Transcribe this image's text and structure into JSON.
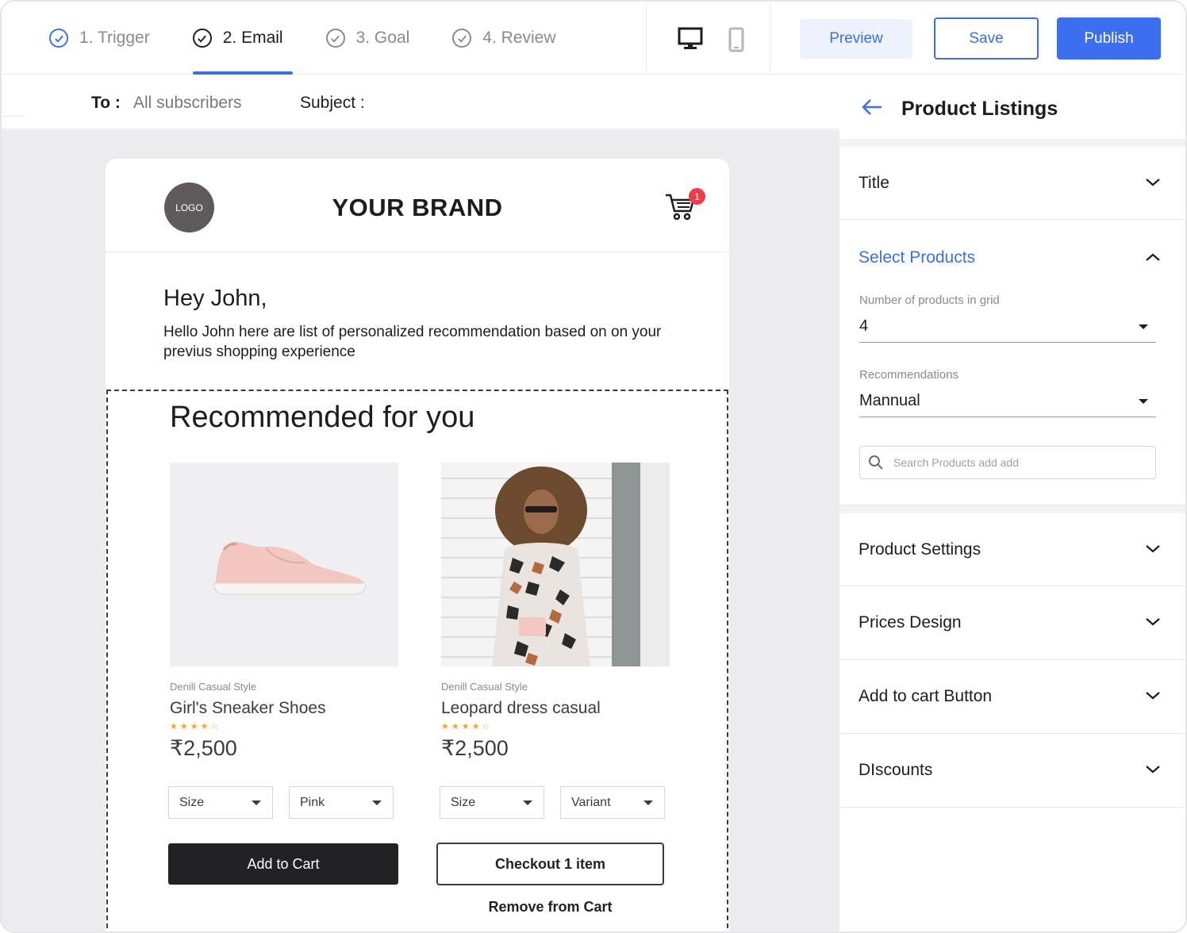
{
  "steps": [
    {
      "label": "1. Trigger",
      "state": "done"
    },
    {
      "label": "2. Email",
      "state": "active"
    },
    {
      "label": "3. Goal",
      "state": "pending"
    },
    {
      "label": "4. Review",
      "state": "pending"
    }
  ],
  "toolbar": {
    "preview": "Preview",
    "save": "Save",
    "publish": "Publish"
  },
  "address": {
    "to_label": "To :",
    "to_value": "All subscribers",
    "subject_label": "Subject :"
  },
  "email": {
    "logo": "LOGO",
    "brand": "YOUR BRAND",
    "cart_count": "1",
    "greeting": "Hey John,",
    "intro": "Hello John here are list of personalized recommendation based on on your previus shopping experience",
    "section_title": "Recommended for you",
    "products": [
      {
        "brand": "Denill Casual Style",
        "name": "Girl's Sneaker Shoes",
        "rating": 4,
        "price": "₹2,500",
        "selects": [
          "Size",
          "Pink"
        ]
      },
      {
        "brand": "Denill Casual Style",
        "name": "Leopard dress casual",
        "rating": 4,
        "price": "₹2,500",
        "selects": [
          "Size",
          "Variant"
        ]
      }
    ],
    "add_to_cart": "Add to Cart",
    "checkout": "Checkout 1 item",
    "remove": "Remove from Cart"
  },
  "panel": {
    "title": "Product Listings",
    "sections": {
      "title": "Title",
      "select_products": "Select Products",
      "product_settings": "Product Settings",
      "prices_design": "Prices Design",
      "add_to_cart_button": "Add to cart Button",
      "discounts": "DIscounts"
    },
    "grid_label": "Number of products in grid",
    "grid_value": "4",
    "rec_label": "Recommendations",
    "rec_value": "Mannual",
    "search_placeholder": "Search Products add add"
  },
  "colors": {
    "accent": "#3b6ff0",
    "badge": "#ef3b4e",
    "star": "#f0a829",
    "dark_button": "#222124"
  }
}
